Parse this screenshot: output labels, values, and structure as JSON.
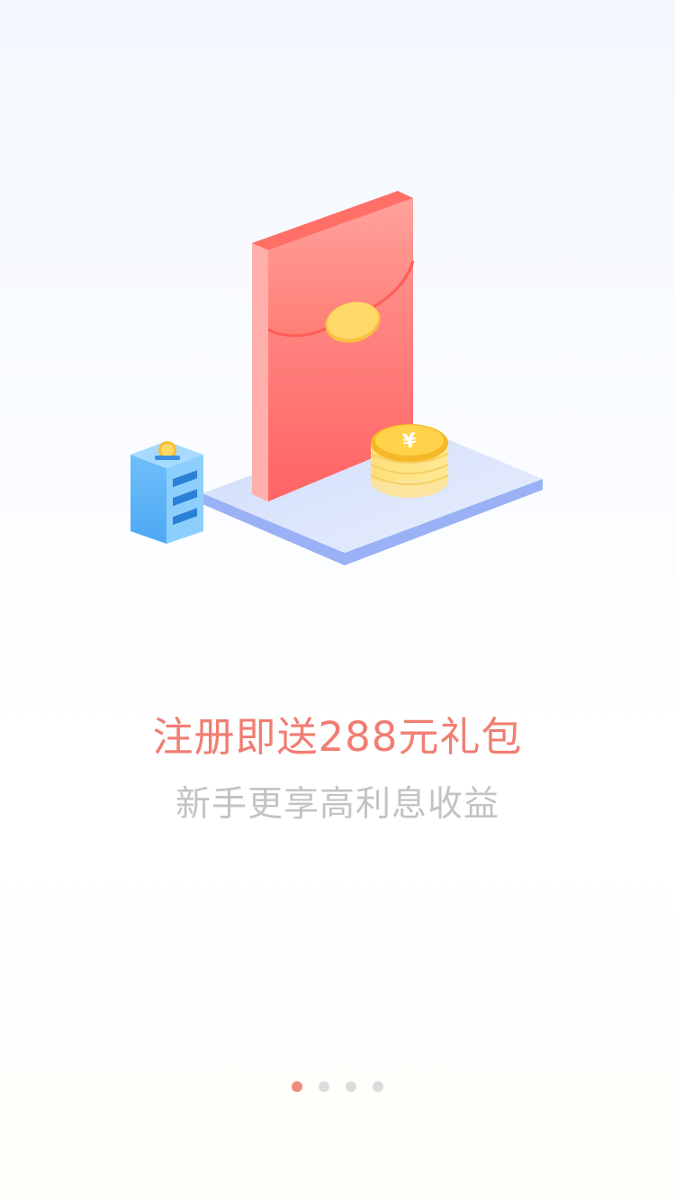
{
  "onboarding": {
    "headline": "注册即送288元礼包",
    "subline": "新手更享高利息收益",
    "pager": {
      "page_count": 4,
      "active_index": 0
    }
  },
  "colors": {
    "headline": "#f07e72",
    "subline": "#c3c3c3",
    "dot_active": "#f08a80",
    "dot_inactive": "#dcdcdc"
  },
  "icons": {
    "currency_symbol": "¥"
  }
}
